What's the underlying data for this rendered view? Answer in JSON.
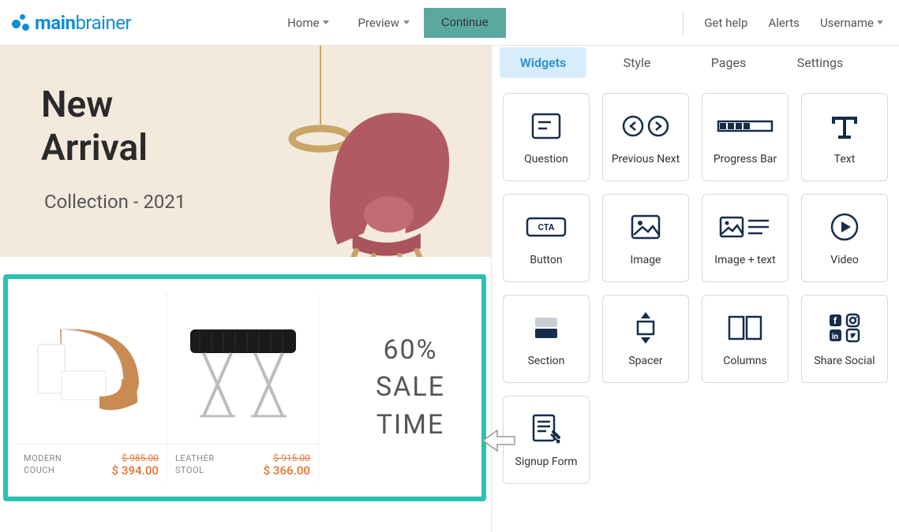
{
  "logo": {
    "main": "main",
    "brainer": "brainer"
  },
  "nav": {
    "home": "Home",
    "preview": "Preview",
    "continue": "Continue",
    "gethelp": "Get help",
    "alerts": "Alerts",
    "username": "Username"
  },
  "hero": {
    "title_line1": "New",
    "title_line2": "Arrival",
    "subtitle": "Collection - 2021"
  },
  "products": [
    {
      "name_line1": "MODERN",
      "name_line2": "COUCH",
      "old": "$ 985.00",
      "new": "$ 394.00"
    },
    {
      "name_line1": "LEATHER",
      "name_line2": "STOOL",
      "old": "$ 915.00",
      "new": "$ 366.00"
    }
  ],
  "sale": {
    "l1": "60%",
    "l2": "SALE",
    "l3": "TIME"
  },
  "tabs": {
    "widgets": "Widgets",
    "style": "Style",
    "pages": "Pages",
    "settings": "Settings"
  },
  "widgets": {
    "question": "Question",
    "prevnext": "Previous Next",
    "progress": "Progress Bar",
    "text": "Text",
    "button": "Button",
    "image": "Image",
    "imagetext": "Image + text",
    "video": "Video",
    "section": "Section",
    "spacer": "Spacer",
    "columns": "Columns",
    "social": "Share Social",
    "signup": "Signup Form"
  }
}
